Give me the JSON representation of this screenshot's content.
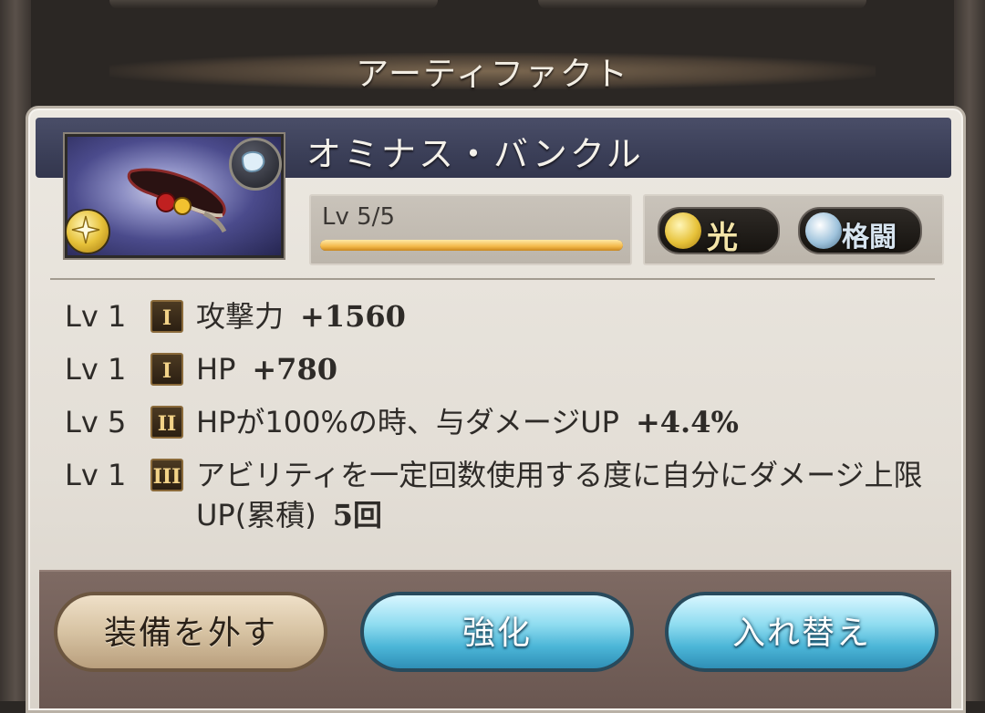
{
  "header": {
    "title": "アーティファクト"
  },
  "artifact": {
    "name": "オミナス・バンクル",
    "level_text": "Lv 5/5",
    "level_progress": 1.0,
    "element": {
      "icon": "light-element-icon",
      "label": "光"
    },
    "weapon_type": {
      "icon": "gauntlet-icon",
      "label": "格闘"
    }
  },
  "skills": [
    {
      "lv": "Lv 1",
      "rank": "I",
      "desc": "攻撃力",
      "value": "+1560"
    },
    {
      "lv": "Lv 1",
      "rank": "I",
      "desc": "HP",
      "value": "+780"
    },
    {
      "lv": "Lv 5",
      "rank": "II",
      "desc": "HPが100%の時、与ダメージUP",
      "value": "+4.4%"
    },
    {
      "lv": "Lv 1",
      "rank": "III",
      "desc": "アビリティを一定回数使用する度に自分にダメージ上限UP(累積)",
      "value": "5回"
    }
  ],
  "buttons": {
    "unequip": "装備を外す",
    "upgrade": "強化",
    "swap": "入れ替え"
  },
  "colors": {
    "name_bar": "#3b3f58",
    "blue_button": "#4cb6d8",
    "panel": "#e3ded6"
  }
}
